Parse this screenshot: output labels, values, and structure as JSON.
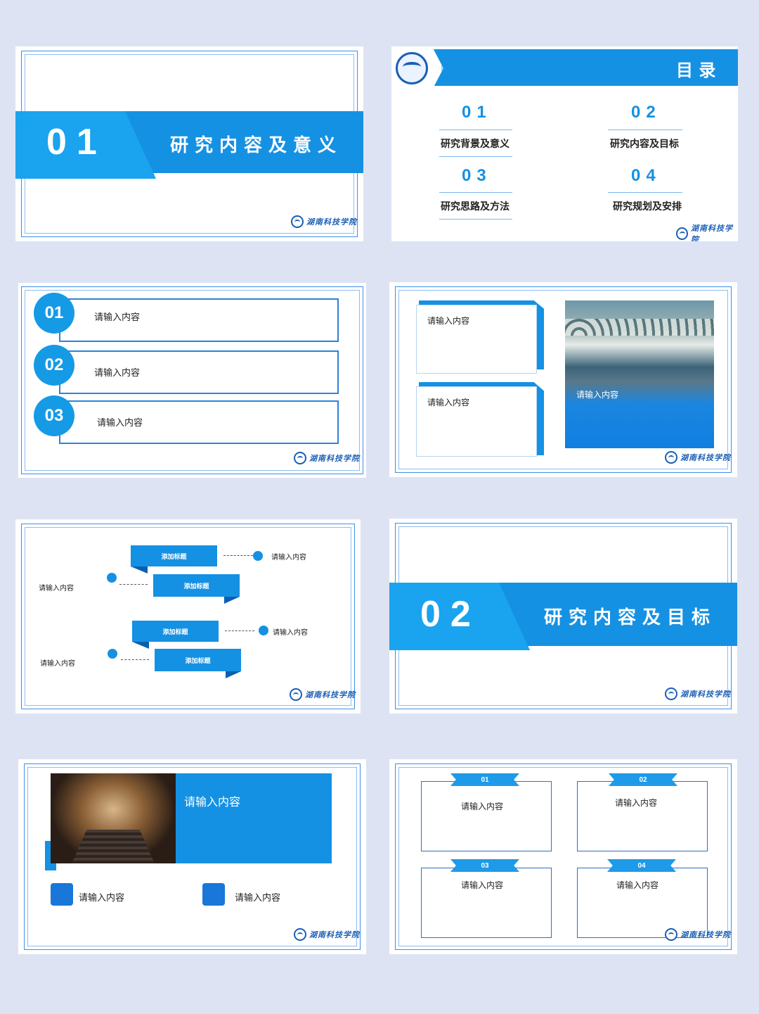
{
  "logo_text": "湖南科技学院",
  "slide1": {
    "number": "01",
    "title": "研究内容及意义"
  },
  "slide2": {
    "header": "目 录",
    "items": [
      {
        "num": "01",
        "label": "研究背景及意义"
      },
      {
        "num": "02",
        "label": "研究内容及目标"
      },
      {
        "num": "03",
        "label": "研究思路及方法"
      },
      {
        "num": "04",
        "label": "研究规划及安排"
      }
    ]
  },
  "slide3": {
    "rows": [
      {
        "num": "01",
        "text": "请输入内容"
      },
      {
        "num": "02",
        "text": "请输入内容"
      },
      {
        "num": "03",
        "text": "请输入内容"
      }
    ]
  },
  "slide4": {
    "card1": "请输入内容",
    "card2": "请输入内容",
    "photo_caption": "请输入内容"
  },
  "slide5": {
    "ribbons": [
      "添加标题",
      "添加标题",
      "添加标题",
      "添加标题"
    ],
    "right_texts": [
      "请输入内容",
      "请输入内容"
    ],
    "left_texts": [
      "请输入内容",
      "请输入内容"
    ]
  },
  "slide6": {
    "number": "02",
    "title": "研究内容及目标"
  },
  "slide7": {
    "banner_text": "请输入内容",
    "item1": "请输入内容",
    "item2": "请输入内容"
  },
  "slide8": {
    "boxes": [
      {
        "num": "01",
        "text": "请输入内容"
      },
      {
        "num": "02",
        "text": "请输入内容"
      },
      {
        "num": "03",
        "text": "请输入内容"
      },
      {
        "num": "04",
        "text": "请输入内容"
      }
    ]
  },
  "colors": {
    "accent": "#1591e3",
    "frame": "#3d8fe6",
    "background": "#dde3f3"
  }
}
